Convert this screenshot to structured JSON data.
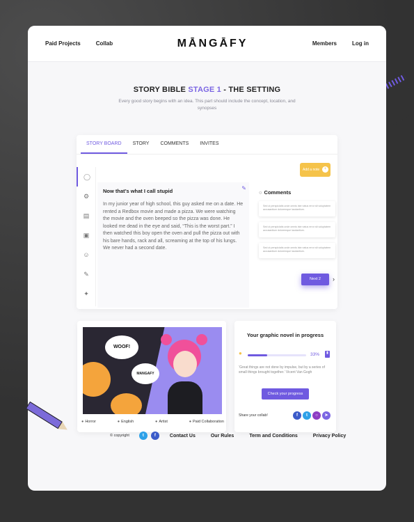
{
  "header": {
    "nav_left": [
      "Paid Projects",
      "Collab"
    ],
    "logo": "MĀNGĀFY",
    "nav_right": [
      "Members",
      "Log in"
    ]
  },
  "hero": {
    "title_prefix": "STORY BIBLE ",
    "title_accent": "STAGE 1",
    "title_suffix": " - THE SETTING",
    "subtitle": "Every good story begins with an idea. This part should include the concept, location, and synopses"
  },
  "board": {
    "tabs": [
      "STORY BOARD",
      "STORY",
      "COMMENTS",
      "INVITES"
    ],
    "active_tab": "STORY BOARD",
    "side_icons": [
      "lightbulb-icon",
      "tools-icon",
      "document-icon",
      "book-icon",
      "character-icon",
      "pencil-icon",
      "share-icon"
    ],
    "add_button": "Add a note",
    "editor_title": "Now that’s what I call stupid",
    "editor_text": "In my junior year of high school, this guy asked me on a date. He rented a Redbox movie and made a pizza. We were watching the movie and the oven beeped so the pizza was done. He looked me dead in the eye and said, “This is the worst part.” I then watched this boy open the oven and pull the pizza out with his bare hands, rack and all, screaming at the top of his lungs. We never had a second date.",
    "comments_title": "Comments",
    "comments": [
      "Sed ut perspiciatis unde omnis iste natus error sit voluptatem accusantium doloremque laudantium.",
      "Sed ut perspiciatis unde omnis iste natus error sit voluptatem accusantium doloremque laudantium.",
      "Sed ut perspiciatis unde omnis iste natus error sit voluptatem accusantium doloremque laudantium."
    ],
    "next_button": "Next 2"
  },
  "art": {
    "bubble_1": "WOOF!",
    "bubble_2": "MANGAFY",
    "tags": [
      "Horror",
      "English",
      "Artist",
      "Paid Collaboration"
    ]
  },
  "progress": {
    "title": "Your graphic novel in progress",
    "percent_label": "33%",
    "percent_value": 33,
    "quote": "‘Great things are not done by impulse, but by a series of small things brought together.’ Vicent Van Gogh",
    "check_button": "Check your progress",
    "share_label": "Share your collab!",
    "socials": [
      "facebook-icon",
      "twitter-icon",
      "instagram-icon",
      "telegram-icon"
    ]
  },
  "footer": {
    "copyright": "© copyright",
    "links": [
      "Contact Us",
      "Our Rules",
      "Term and Conditions",
      "Privacy Policy"
    ]
  },
  "colors": {
    "accent": "#6f5ae0",
    "yellow": "#f5c34a"
  }
}
